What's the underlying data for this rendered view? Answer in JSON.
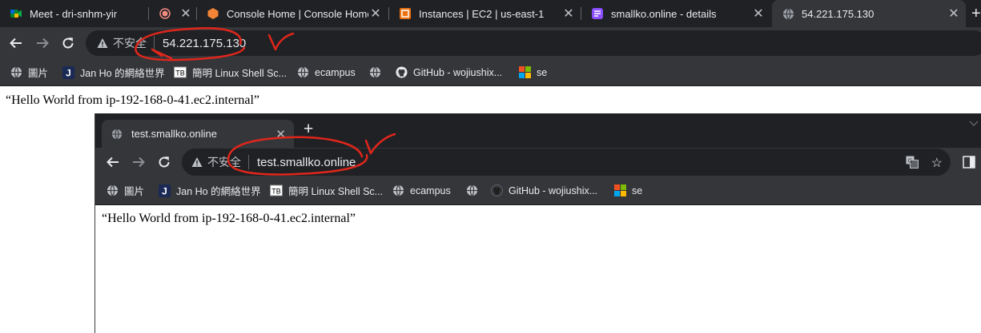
{
  "outer": {
    "tabs": [
      {
        "label": "Meet - dri-snhm-yir",
        "icon": "google-meet-icon"
      },
      {
        "label": "",
        "icon": "recording-icon"
      },
      {
        "label": "Console Home | Console Home",
        "icon": "aws-console-icon"
      },
      {
        "label": "Instances | EC2 | us-east-1",
        "icon": "ec2-icon"
      },
      {
        "label": "smallko.online - details",
        "icon": "dns-icon"
      },
      {
        "label": "54.221.175.130",
        "icon": "globe-icon"
      }
    ],
    "new_tab": "+",
    "omnibox": {
      "insecure": "不安全",
      "url": "54.221.175.130"
    },
    "bookmarks": [
      {
        "label": "圖片",
        "icon": "globe-icon"
      },
      {
        "label": "Jan Ho 的網絡世界",
        "icon": "j-icon"
      },
      {
        "label": "簡明 Linux Shell Sc...",
        "icon": "tb-icon"
      },
      {
        "label": "ecampus",
        "icon": "globe-icon"
      },
      {
        "label": "",
        "icon": "globe-icon"
      },
      {
        "label": "GitHub - wojiushix...",
        "icon": "github-icon"
      },
      {
        "label": "se",
        "icon": "microsoft-icon"
      }
    ],
    "page_text": "“Hello World from ip-192-168-0-41.ec2.internal”"
  },
  "inner": {
    "tab_label": "test.smallko.online",
    "new_tab": "+",
    "omnibox": {
      "insecure": "不安全",
      "url": "test.smallko.online"
    },
    "bookmarks": [
      {
        "label": "圖片",
        "icon": "globe-icon"
      },
      {
        "label": "Jan Ho 的網絡世界",
        "icon": "j-icon"
      },
      {
        "label": "簡明 Linux Shell Sc...",
        "icon": "tb-icon"
      },
      {
        "label": "ecampus",
        "icon": "globe-icon"
      },
      {
        "label": "",
        "icon": "globe-icon"
      },
      {
        "label": "GitHub - wojiushix...",
        "icon": "github-icon"
      },
      {
        "label": "se",
        "icon": "microsoft-icon"
      }
    ],
    "page_text": "“Hello World from ip-192-168-0-41.ec2.internal”"
  },
  "colors": {
    "chrome_dark": "#202124",
    "chrome_toolbar": "#35363a",
    "annotation_red": "#e0261b"
  }
}
